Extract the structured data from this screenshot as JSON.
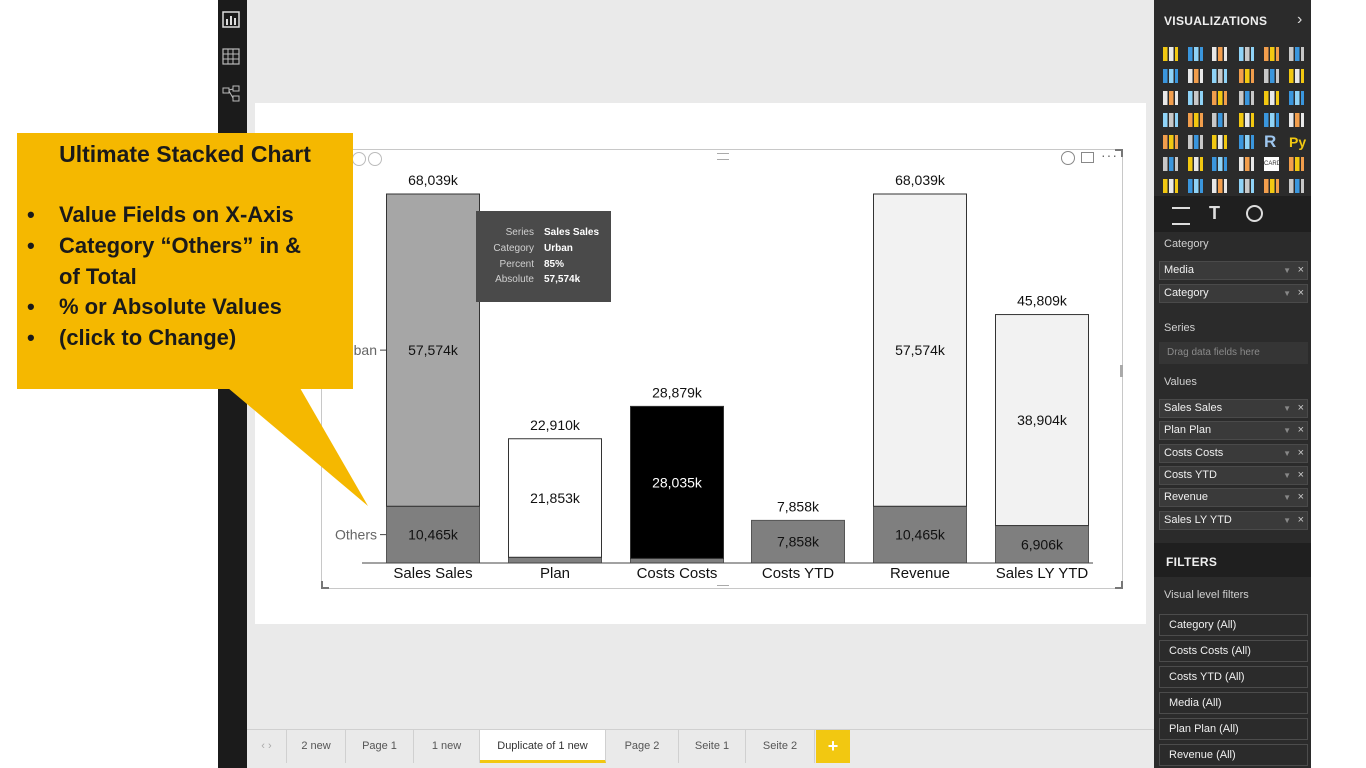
{
  "callout": {
    "title": "Ultimate Stacked Chart",
    "bullets": [
      "Value Fields on X-Axis",
      "Category “Others” in &",
      "of Total",
      "% or Absolute Values",
      "(click to Change)"
    ]
  },
  "tooltip": {
    "rows": [
      {
        "key": "Series",
        "value": "Sales Sales"
      },
      {
        "key": "Category",
        "value": "Urban"
      },
      {
        "key": "Percent",
        "value": "85%"
      },
      {
        "key": "Absolute",
        "value": "57,574k"
      }
    ]
  },
  "chart_data": {
    "type": "bar",
    "stacked": true,
    "categories": [
      "Sales Sales",
      "Plan",
      "Costs Costs",
      "Costs YTD",
      "Revenue",
      "Sales LY YTD"
    ],
    "series": [
      {
        "name": "Others",
        "values": [
          10465,
          1057,
          844,
          7858,
          10465,
          6906
        ],
        "labels": [
          "10,465k",
          "",
          "",
          "7,858k",
          "10,465k",
          "6,906k"
        ]
      },
      {
        "name": "Urban",
        "values": [
          57574,
          21853,
          28035,
          0,
          57574,
          38904
        ],
        "labels": [
          "57,574k",
          "21,853k",
          "28,035k",
          "",
          "57,574k",
          "38,904k"
        ]
      }
    ],
    "totals": [
      68039,
      22910,
      28879,
      7858,
      68039,
      45809
    ],
    "total_labels": [
      "68,039k",
      "22,910k",
      "28,879k",
      "7,858k",
      "68,039k",
      "45,809k"
    ],
    "y_axis_labels": [
      "Others",
      "ban"
    ],
    "ylim": [
      0,
      68039
    ],
    "legend": "none",
    "grid": false,
    "colors": {
      "others": "#7f7f7f",
      "urban_sales": "#a6a6a6",
      "urban_light": "#f2f2f2",
      "urban_plan": "#ffffff",
      "urban_costs": "#000000"
    }
  },
  "visual_header_icons": [
    "pin-icon",
    "focus-icon",
    "more-options-icon"
  ],
  "left_rail": {
    "icons": [
      "report-view-icon",
      "data-view-icon",
      "relationships-view-icon"
    ]
  },
  "tabs": {
    "items": [
      {
        "label": "2 new",
        "active": false
      },
      {
        "label": "Page 1",
        "active": false
      },
      {
        "label": "1 new",
        "active": false
      },
      {
        "label": "Duplicate of 1 new",
        "active": true
      },
      {
        "label": "Page 2",
        "active": false
      },
      {
        "label": "Seite 1",
        "active": false
      },
      {
        "label": "Seite 2",
        "active": false
      }
    ],
    "add_label": "+"
  },
  "visualizations": {
    "header": "VISUALIZATIONS",
    "r_label": "R",
    "py_label": "Py",
    "card_label": "CARD",
    "fields_tabs": [
      "fields-icon",
      "format-icon",
      "analytics-icon"
    ],
    "wells": {
      "category_label": "Category",
      "category_fields": [
        "Media",
        "Category"
      ],
      "series_label": "Series",
      "series_placeholder": "Drag data fields here",
      "values_label": "Values",
      "values_fields": [
        "Sales Sales",
        "Plan Plan",
        "Costs Costs",
        "Costs YTD",
        "Revenue",
        "Sales LY YTD"
      ]
    }
  },
  "filters": {
    "header": "FILTERS",
    "section_label": "Visual level filters",
    "items": [
      "Category (All)",
      "Costs Costs (All)",
      "Costs YTD (All)",
      "Media (All)",
      "Plan Plan (All)",
      "Revenue (All)"
    ]
  },
  "accent_color": "#f2c811"
}
